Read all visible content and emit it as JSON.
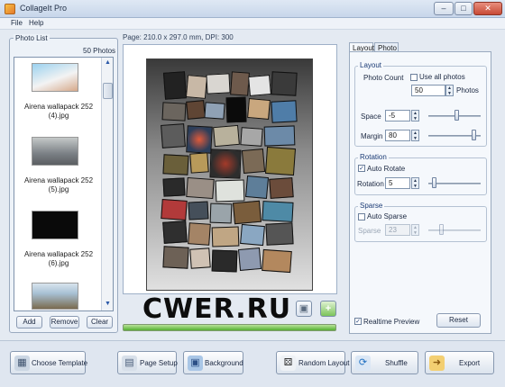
{
  "window": {
    "title": "CollageIt Pro",
    "buttons": {
      "minimize": "–",
      "maximize": "□",
      "close": "✕"
    }
  },
  "menu": [
    "File",
    "Help"
  ],
  "photo_list": {
    "title": "Photo List",
    "count": "50 Photos",
    "items": [
      {
        "line1": "Airena wallapack 252",
        "line2": "(4).jpg"
      },
      {
        "line1": "Airena wallapack 252",
        "line2": "(5).jpg"
      },
      {
        "line1": "Airena wallapack 252",
        "line2": "(6).jpg"
      }
    ],
    "buttons": {
      "add": "Add",
      "remove": "Remove",
      "clear": "Clear"
    }
  },
  "page": {
    "info": "Page: 210.0 x 297.0 mm, DPI: 300",
    "watermark": "CWER.RU"
  },
  "tabs": [
    "Layout",
    "Photo"
  ],
  "layout": {
    "group_title": "Layout",
    "photo_count_label": "Photo Count",
    "use_all_photos": "Use all photos",
    "photo_count_value": "50",
    "photos_unit": "Photos",
    "space_label": "Space",
    "space_value": "-5",
    "margin_label": "Margin",
    "margin_value": "80",
    "space_slider_level": 0.55,
    "margin_slider_level": 0.9
  },
  "rotation": {
    "group_title": "Rotation",
    "auto_rotate": "Auto Rotate",
    "auto_rotate_checked": true,
    "rotation_label": "Rotation",
    "rotation_value": "5",
    "slider_level": 0.08
  },
  "sparse": {
    "group_title": "Sparse",
    "auto_sparse": "Auto Sparse",
    "auto_sparse_checked": false,
    "sparse_label": "Sparse",
    "sparse_value": "23"
  },
  "preview": {
    "realtime_preview": "Realtime Preview",
    "realtime_checked": true,
    "reset": "Reset"
  },
  "toolbar": {
    "choose_template": "Choose Template",
    "page_setup": "Page Setup",
    "background": "Background",
    "random_layout": "Random Layout",
    "shuffle": "Shuffle",
    "export": "Export"
  }
}
